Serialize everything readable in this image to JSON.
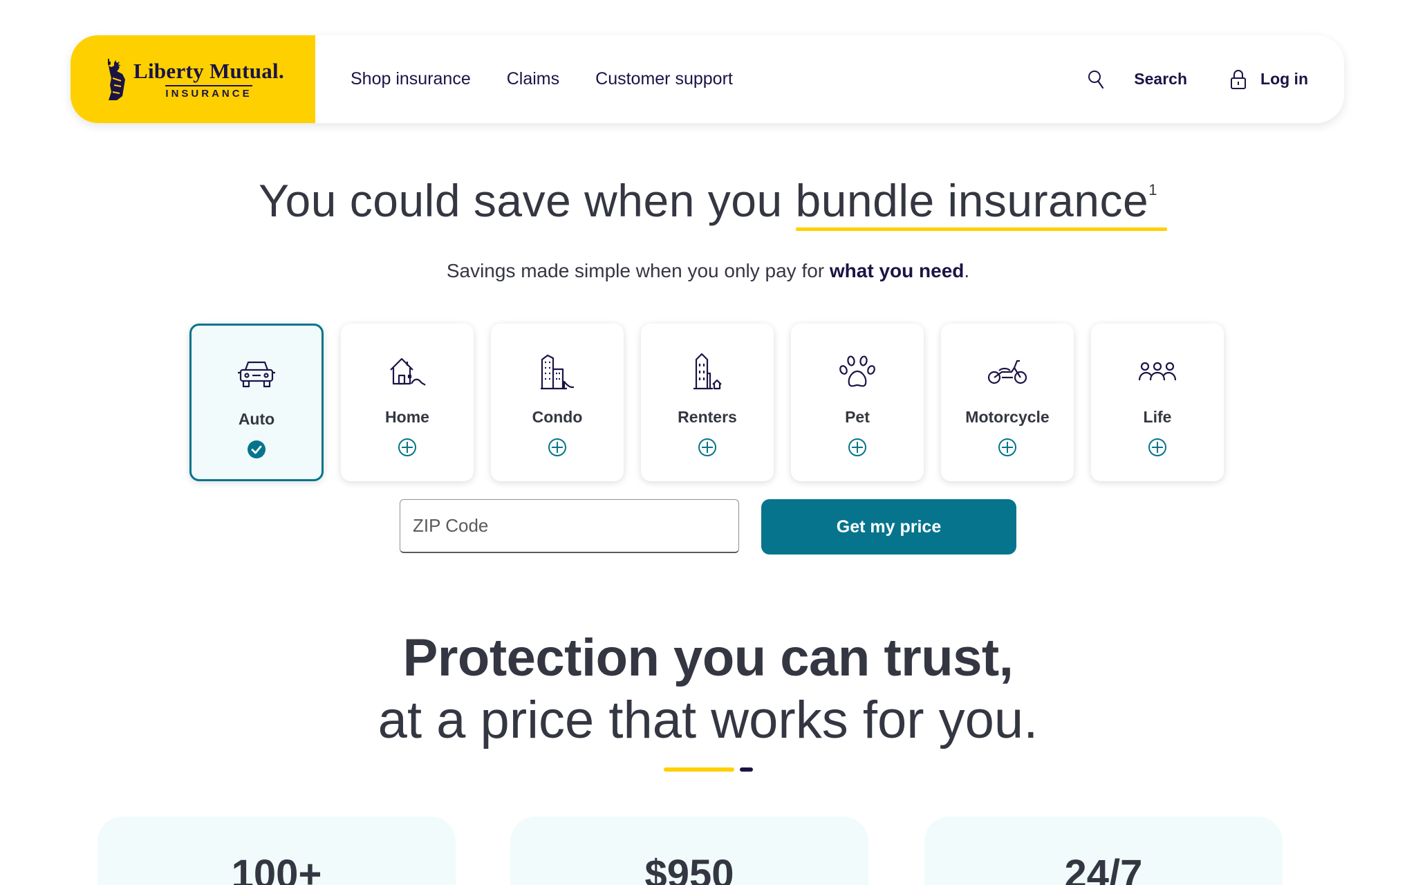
{
  "header": {
    "logo_brand": "Liberty Mutual.",
    "logo_sub": "INSURANCE",
    "nav": [
      "Shop insurance",
      "Claims",
      "Customer support"
    ],
    "search_label": "Search",
    "login_label": "Log in"
  },
  "hero": {
    "title_prefix": "You could save when you ",
    "title_highlight": "bundle insurance",
    "title_footnote": "1",
    "subtitle_prefix": "Savings made simple when you only pay for ",
    "subtitle_bold": "what you need",
    "subtitle_suffix": "."
  },
  "products": [
    {
      "label": "Auto",
      "icon": "car-icon",
      "selected": true
    },
    {
      "label": "Home",
      "icon": "house-icon",
      "selected": false
    },
    {
      "label": "Condo",
      "icon": "condo-building-icon",
      "selected": false
    },
    {
      "label": "Renters",
      "icon": "renters-building-icon",
      "selected": false
    },
    {
      "label": "Pet",
      "icon": "paw-icon",
      "selected": false
    },
    {
      "label": "Motorcycle",
      "icon": "motorcycle-icon",
      "selected": false
    },
    {
      "label": "Life",
      "icon": "people-icon",
      "selected": false
    }
  ],
  "quote_form": {
    "zip_placeholder": "ZIP Code",
    "zip_value": "",
    "cta_label": "Get my price"
  },
  "trust": {
    "heading_bold": "Protection you can trust,",
    "heading_light": "at a price that works for you."
  },
  "stats": [
    "100+",
    "$950",
    "24/7"
  ],
  "colors": {
    "brand_yellow": "#ffd000",
    "brand_navy": "#1a1446",
    "accent_teal": "#06748c",
    "selected_bg": "#f1fbfc",
    "text": "#343741"
  }
}
